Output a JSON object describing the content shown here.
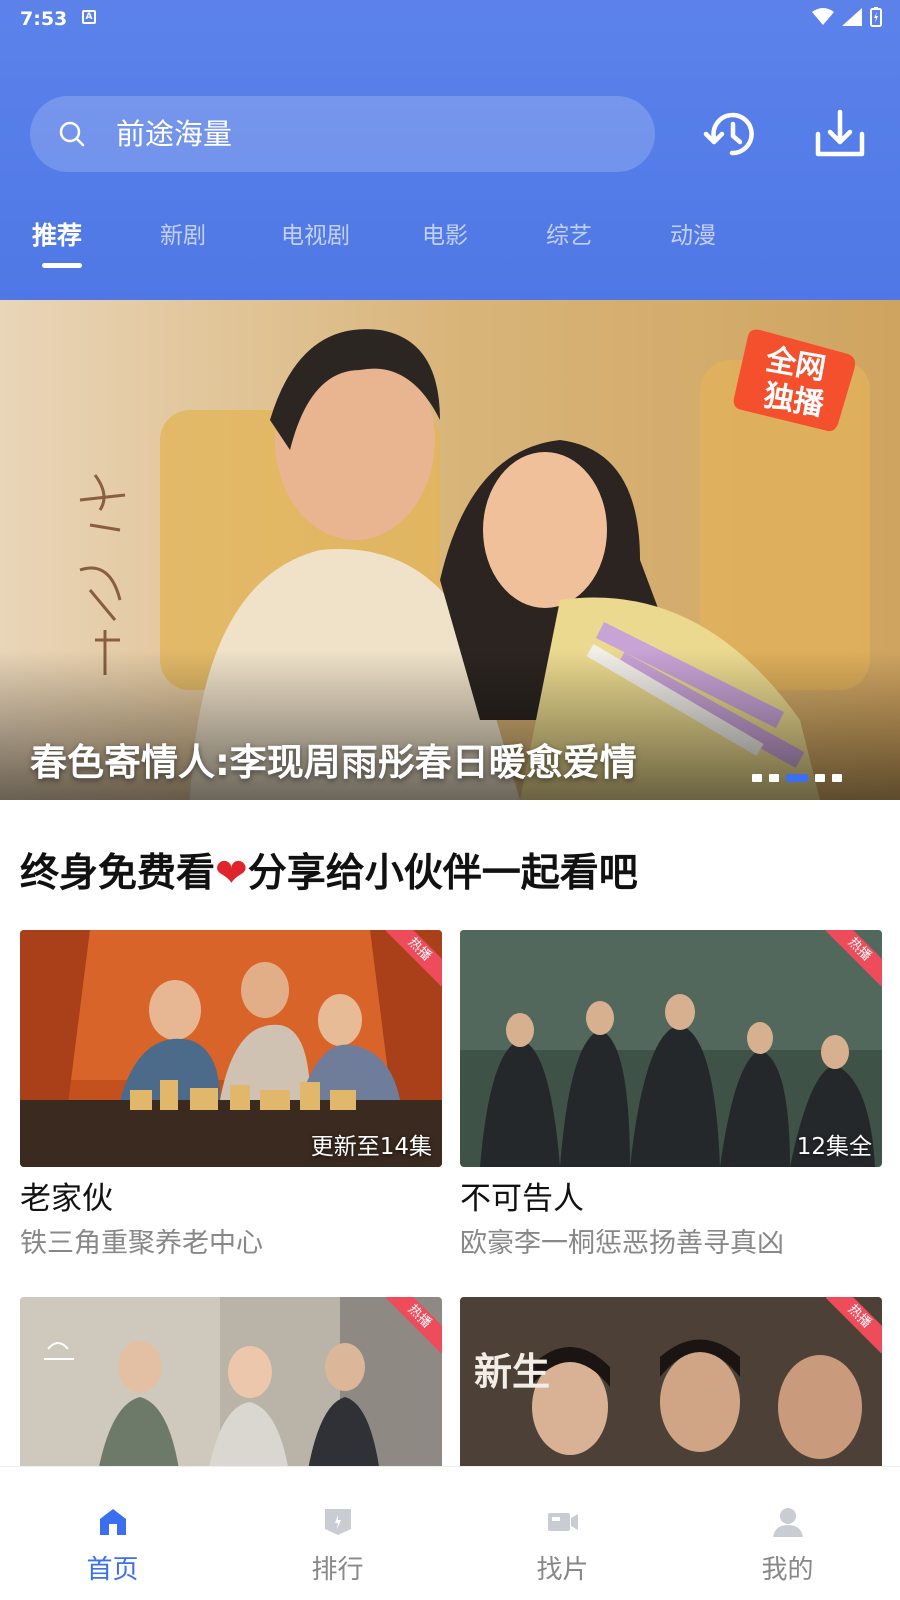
{
  "status_bar": {
    "time": "7:53",
    "notification_icon": "A"
  },
  "search": {
    "placeholder": "前途海量"
  },
  "header_buttons": [
    "history-icon",
    "download-icon"
  ],
  "tabs": [
    {
      "label": "推荐",
      "active": true
    },
    {
      "label": "新剧"
    },
    {
      "label": "电视剧"
    },
    {
      "label": "电影"
    },
    {
      "label": "综艺"
    },
    {
      "label": "动漫"
    }
  ],
  "banner": {
    "caption": "春色寄情人:李现周雨彤春日暖愈爱情",
    "badge": "全网独播",
    "dots": 5,
    "active_dot": 2
  },
  "section": {
    "title_part1": "终身免费看",
    "heart": "❤",
    "title_part2": "分享给小伙伴一起看吧"
  },
  "cards": [
    {
      "title": "老家伙",
      "subtitle": "铁三角重聚养老中心",
      "episodes": "更新至14集",
      "tag": "热播"
    },
    {
      "title": "不可告人",
      "subtitle": "欧豪李一桐惩恶扬善寻真凶",
      "episodes": "12集全",
      "tag": "热播"
    },
    {
      "title": "",
      "subtitle": "",
      "episodes": "",
      "tag": "热播"
    },
    {
      "title": "",
      "subtitle": "",
      "episodes": "",
      "tag": "热播",
      "poster_text": "新生"
    }
  ],
  "bottom_nav": [
    {
      "label": "首页",
      "icon": "home-icon",
      "active": true
    },
    {
      "label": "排行",
      "icon": "ranking-icon"
    },
    {
      "label": "找片",
      "icon": "video-icon"
    },
    {
      "label": "我的",
      "icon": "profile-icon"
    }
  ],
  "colors": {
    "accent": "#3b6ff0",
    "header": "#5c82ea",
    "hot_tag": "#ee4b5b"
  }
}
